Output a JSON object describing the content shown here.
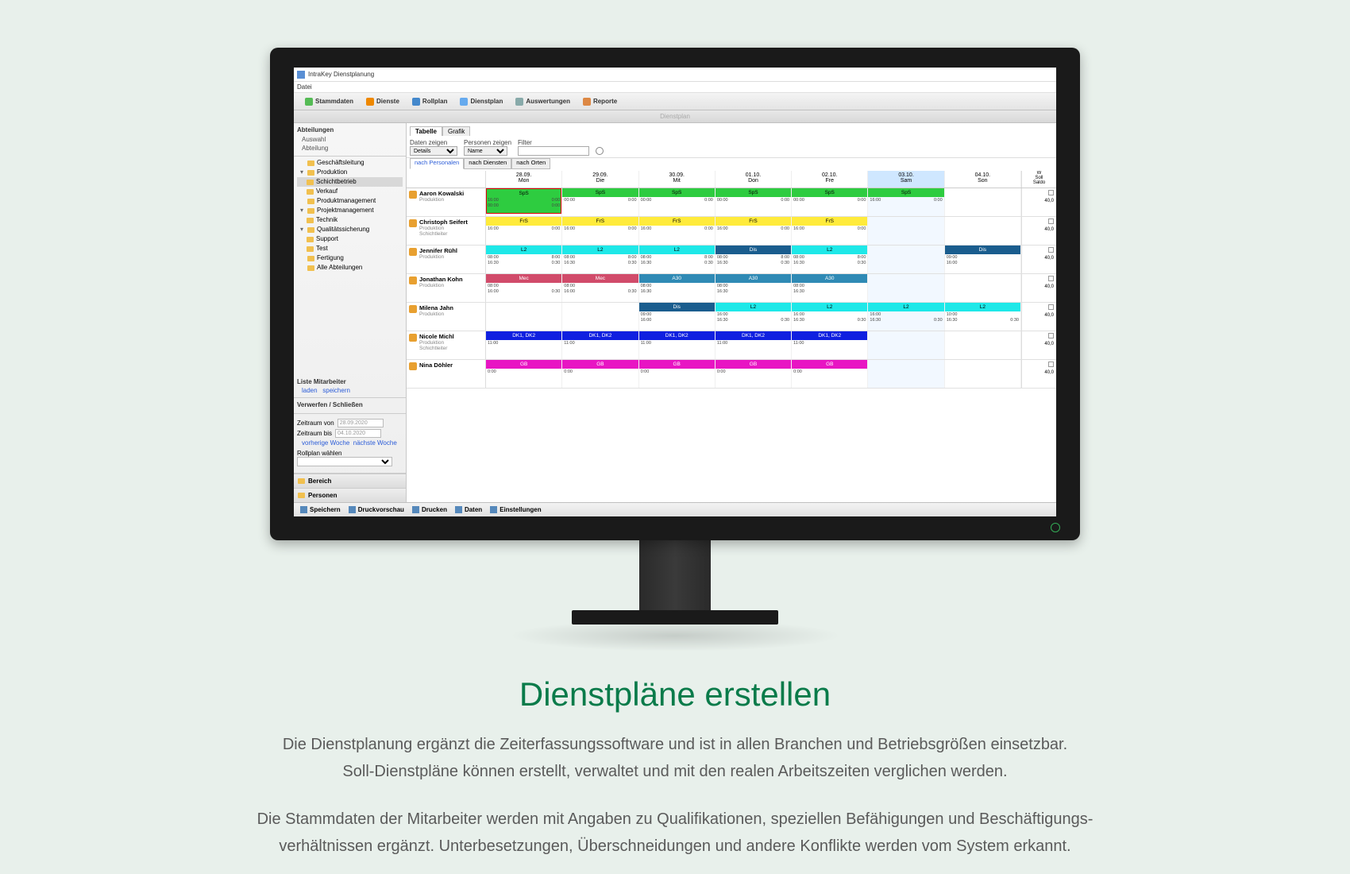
{
  "app": {
    "title": "IntraKey Dienstplanung",
    "menu_datei": "Datei"
  },
  "maintabs": {
    "stammdaten": "Stammdaten",
    "dienste": "Dienste",
    "rollplan": "Rollplan",
    "dienstplan": "Dienstplan",
    "auswertungen": "Auswertungen",
    "reporte": "Reporte"
  },
  "subheader": "Dienstplan",
  "sidebar": {
    "abteilungen_hdr": "Abteilungen",
    "auswahl": "Auswahl",
    "abteilung": "Abteilung",
    "tree": {
      "geschaeftsleitung": "Geschäftsleitung",
      "produktion": "Produktion",
      "schichtbetrieb": "Schichtbetrieb",
      "verkauf": "Verkauf",
      "produktmanagement": "Produktmanagement",
      "projektmanagement": "Projektmanagement",
      "technik": "Technik",
      "qsicherung": "Qualitätssicherung",
      "support": "Support",
      "test": "Test",
      "fertigung": "Fertigung",
      "alle": "Alle Abteilungen"
    },
    "liste_hdr": "Liste Mitarbeiter",
    "laden": "laden",
    "speichern": "speichern",
    "verwerfen_hdr": "Verwerfen / Schließen",
    "zeitraum_von": "Zeitraum von",
    "zeitraum_bis": "Zeitraum bis",
    "date_from": "28.09.2020",
    "date_to": "04.10.2020",
    "vorherige": "vorherige Woche",
    "naechste": "nächste Woche",
    "rollplan_w": "Rollplan wählen",
    "bereich": "Bereich",
    "personen": "Personen"
  },
  "viewtabs": {
    "tabelle": "Tabelle",
    "grafik": "Grafik"
  },
  "filter": {
    "daten_zeigen_lbl": "Daten zeigen",
    "daten_zeigen_val": "Details",
    "personen_lbl": "Personen zeigen",
    "personen_val": "Name",
    "filter_lbl": "Filter",
    "filter_val": ""
  },
  "modetabs": {
    "personalen": "nach Personalen",
    "diensten": "nach Diensten",
    "orten": "nach Orten"
  },
  "days": [
    {
      "date": "28.09.",
      "dow": "Mon",
      "highlight": false
    },
    {
      "date": "29.09.",
      "dow": "Die",
      "highlight": false
    },
    {
      "date": "30.09.",
      "dow": "Mit",
      "highlight": false
    },
    {
      "date": "01.10.",
      "dow": "Don",
      "highlight": false
    },
    {
      "date": "02.10.",
      "dow": "Fre",
      "highlight": false
    },
    {
      "date": "03.10.",
      "dow": "Sam",
      "highlight": true
    },
    {
      "date": "04.10.",
      "dow": "Son",
      "highlight": false
    }
  ],
  "sum_header": {
    "l1": "W",
    "l2": "Soll",
    "l3": "Saldo"
  },
  "rows": [
    {
      "name": "Aaron Kowalski",
      "dept": "Produktion",
      "shifts": [
        {
          "label": "SpS",
          "color": "#2ecc40",
          "t1": "16:00",
          "t2": "0:00",
          "t3": "00:00",
          "t4": "0:00",
          "selected": true
        },
        {
          "label": "SpS",
          "color": "#2ecc40",
          "t1": "00:00",
          "t2": "0:00"
        },
        {
          "label": "SpS",
          "color": "#2ecc40",
          "t1": "00:00",
          "t2": "0:00"
        },
        {
          "label": "SpS",
          "color": "#2ecc40",
          "t1": "00:00",
          "t2": "0:00"
        },
        {
          "label": "SpS",
          "color": "#2ecc40",
          "t1": "00:00",
          "t2": "0:00"
        },
        {
          "label": "SpS",
          "color": "#2ecc40",
          "t1": "16:00",
          "t2": "0:00"
        },
        null
      ],
      "sum": "40,0"
    },
    {
      "name": "Christoph Seifert",
      "dept": "Produktion\nSchichtleiter",
      "shifts": [
        {
          "label": "FrS",
          "color": "#ffeb3b",
          "t1": "16:00",
          "t2": "0:00"
        },
        {
          "label": "FrS",
          "color": "#ffeb3b",
          "t1": "16:00",
          "t2": "0:00"
        },
        {
          "label": "FrS",
          "color": "#ffeb3b",
          "t1": "16:00",
          "t2": "0:00"
        },
        {
          "label": "FrS",
          "color": "#ffeb3b",
          "t1": "16:00",
          "t2": "0:00"
        },
        {
          "label": "FrS",
          "color": "#ffeb3b",
          "t1": "16:00",
          "t2": "0:00"
        },
        null,
        null
      ],
      "sum": "40,0"
    },
    {
      "name": "Jennifer Rühl",
      "dept": "Produktion",
      "shifts": [
        {
          "label": "L2",
          "color": "#1ee8e8",
          "t1": "08:00",
          "t2": "8:00",
          "t3": "16:30",
          "t4": "0:30"
        },
        {
          "label": "L2",
          "color": "#1ee8e8",
          "t1": "08:00",
          "t2": "8:00",
          "t3": "16:30",
          "t4": "0:30"
        },
        {
          "label": "L2",
          "color": "#1ee8e8",
          "t1": "08:00",
          "t2": "8:00",
          "t3": "16:30",
          "t4": "0:30"
        },
        {
          "label": "Dis",
          "color": "#1a5d8e",
          "text": "#fff",
          "t1": "08:00",
          "t2": "8:00",
          "t3": "16:30",
          "t4": "0:30"
        },
        {
          "label": "L2",
          "color": "#1ee8e8",
          "t1": "08:00",
          "t2": "8:00",
          "t3": "16:30",
          "t4": "0:30"
        },
        null,
        {
          "label": "Dis",
          "color": "#1a5d8e",
          "text": "#fff",
          "t1": "09:00",
          "t2": "",
          "t3": "16:00",
          "t4": ""
        }
      ],
      "sum": "40,0"
    },
    {
      "name": "Jonathan Kohn",
      "dept": "Produktion",
      "shifts": [
        {
          "label": "Mec",
          "color": "#d14b6a",
          "text": "#fff",
          "t1": "08:00",
          "t2": "",
          "t3": "16:00",
          "t4": "0:30"
        },
        {
          "label": "Mec",
          "color": "#d14b6a",
          "text": "#fff",
          "t1": "08:00",
          "t2": "",
          "t3": "16:00",
          "t4": "0:30"
        },
        {
          "label": "A30",
          "color": "#2f8ab5",
          "text": "#fff",
          "t1": "08:00",
          "t2": "",
          "t3": "16:30",
          "t4": ""
        },
        {
          "label": "A30",
          "color": "#2f8ab5",
          "text": "#fff",
          "t1": "08:00",
          "t2": "",
          "t3": "16:30",
          "t4": ""
        },
        {
          "label": "A30",
          "color": "#2f8ab5",
          "text": "#fff",
          "t1": "08:00",
          "t2": "",
          "t3": "16:30",
          "t4": ""
        },
        null,
        null
      ],
      "sum": "40,0"
    },
    {
      "name": "Milena Jahn",
      "dept": "Produktion",
      "shifts": [
        null,
        null,
        {
          "label": "Dis",
          "color": "#1a5d8e",
          "text": "#fff",
          "t1": "09:00",
          "t2": "",
          "t3": "16:00",
          "t4": ""
        },
        {
          "label": "L2",
          "color": "#1ee8e8",
          "t1": "16:00",
          "t2": "",
          "t3": "16:30",
          "t4": "0:30"
        },
        {
          "label": "L2",
          "color": "#1ee8e8",
          "t1": "16:00",
          "t2": "",
          "t3": "16:30",
          "t4": "0:30"
        },
        {
          "label": "L2",
          "color": "#1ee8e8",
          "t1": "16:00",
          "t2": "",
          "t3": "16:30",
          "t4": "0:30"
        },
        {
          "label": "L2",
          "color": "#1ee8e8",
          "t1": "10:00",
          "t2": "",
          "t3": "16:30",
          "t4": "0:30"
        }
      ],
      "sum": "40,0"
    },
    {
      "name": "Nicole Michl",
      "dept": "Produktion\nSchichtleiter",
      "shifts": [
        {
          "label": "DK1, DK2",
          "color": "#1020e0",
          "text": "#fff",
          "t1": "11:00",
          "t2": ""
        },
        {
          "label": "DK1, DK2",
          "color": "#1020e0",
          "text": "#fff",
          "t1": "11:00",
          "t2": ""
        },
        {
          "label": "DK1, DK2",
          "color": "#1020e0",
          "text": "#fff",
          "t1": "11:00",
          "t2": ""
        },
        {
          "label": "DK1, DK2",
          "color": "#1020e0",
          "text": "#fff",
          "t1": "11:00",
          "t2": ""
        },
        {
          "label": "DK1, DK2",
          "color": "#1020e0",
          "text": "#fff",
          "t1": "11:00",
          "t2": ""
        },
        null,
        null
      ],
      "sum": "40,0"
    },
    {
      "name": "Nina Döhler",
      "dept": "",
      "shifts": [
        {
          "label": "GB",
          "color": "#e815c3",
          "text": "#fff",
          "t1": "0:00"
        },
        {
          "label": "GB",
          "color": "#e815c3",
          "text": "#fff",
          "t1": "0:00"
        },
        {
          "label": "GB",
          "color": "#e815c3",
          "text": "#fff",
          "t1": "0:00"
        },
        {
          "label": "GB",
          "color": "#e815c3",
          "text": "#fff",
          "t1": "0:00"
        },
        {
          "label": "GB",
          "color": "#e815c3",
          "text": "#fff",
          "t1": "0:00"
        },
        null,
        null
      ],
      "sum": "40,0"
    }
  ],
  "bottombar": {
    "speichern": "Speichern",
    "druckvorschau": "Druckvorschau",
    "drucken": "Drucken",
    "daten": "Daten",
    "einstellungen": "Einstellungen"
  },
  "marketing": {
    "headline": "Dienstpläne erstellen",
    "p1": "Die Dienstplanung ergänzt die Zeiterfassungssoftware und ist in allen Branchen und Betriebsgrößen einsetzbar.",
    "p2": "Soll-Dienstpläne können erstellt, verwaltet und mit den realen Arbeitszeiten verglichen werden.",
    "p3": "Die Stammdaten der Mitarbeiter werden mit Angaben zu Qualifikationen, speziellen Befähigungen und Beschäftigungs-",
    "p4": "verhältnissen ergänzt. Unterbesetzungen, Überschneidungen und andere Konflikte werden vom System erkannt."
  }
}
